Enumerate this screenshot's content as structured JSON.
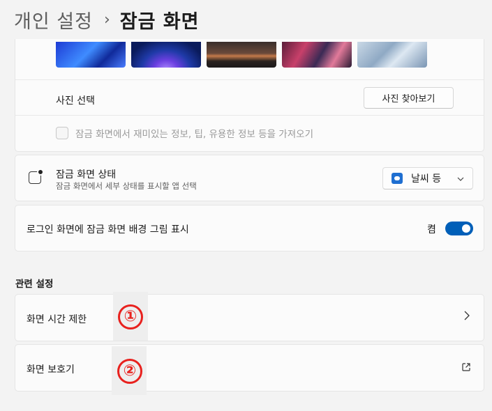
{
  "header": {
    "parent": "개인 설정",
    "separator": "›",
    "current": "잠금 화면"
  },
  "background_card": {
    "thumbnails": [
      "wallpaper-1",
      "wallpaper-2",
      "wallpaper-3",
      "wallpaper-4",
      "wallpaper-5"
    ],
    "choose_photo_label": "사진 선택",
    "browse_button": "사진 찾아보기",
    "fun_facts_checkbox": {
      "label": "잠금 화면에서 재미있는 정보, 팁, 유용한 정보 등을 가져오기",
      "checked": false
    }
  },
  "status_card": {
    "icon": "lock-screen-status-icon",
    "title": "잠금 화면 상태",
    "subtitle": "잠금 화면에서 세부 상태를 표시할 앱 선택",
    "select_value": "날씨 등",
    "select_icon": "weather-icon"
  },
  "login_card": {
    "label": "로그인 화면에 잠금 화면 배경 그림 표시",
    "toggle_state": "켬",
    "toggle_on": true
  },
  "related_settings": {
    "title": "관련 설정",
    "items": [
      {
        "label": "화면 시간 제한",
        "icon": "chevron-right-icon",
        "marker": "①"
      },
      {
        "label": "화면 보호기",
        "icon": "external-link-icon",
        "marker": "②"
      }
    ]
  },
  "colors": {
    "accent": "#005fb8",
    "marker": "#e8211e",
    "background": "#f3f3f3",
    "card": "#fbfbfb"
  }
}
